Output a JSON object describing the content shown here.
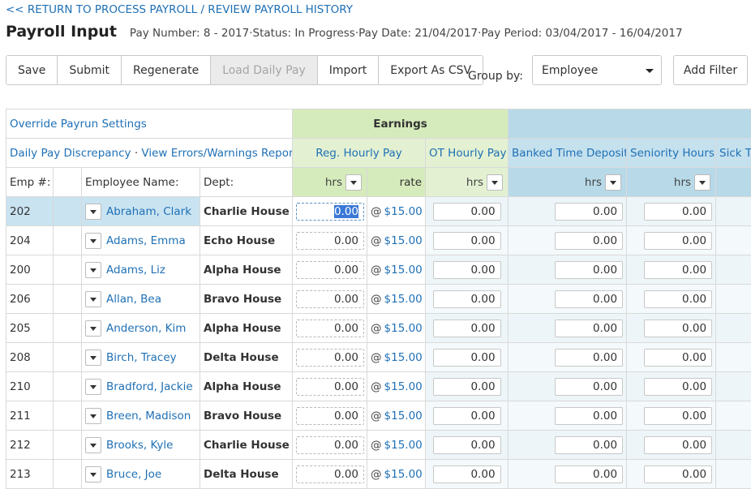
{
  "nav": {
    "return_link": "<< RETURN TO PROCESS PAYROLL / REVIEW PAYROLL HISTORY"
  },
  "header": {
    "title": "Payroll Input",
    "pay_number": "Pay Number: 8 - 2017",
    "status": "Status: In Progress",
    "pay_date": "Pay Date: 21/04/2017",
    "pay_period": "Pay Period: 03/04/2017 - 16/04/2017",
    "separator": "·"
  },
  "toolbar": {
    "save": "Save",
    "submit": "Submit",
    "regenerate": "Regenerate",
    "load_daily_pay": "Load Daily Pay",
    "import": "Import",
    "export_csv": "Export As CSV"
  },
  "group_by": {
    "label": "Group by:",
    "value": "Employee"
  },
  "add_filter": "Add Filter",
  "table": {
    "override_link": "Override Payrun Settings",
    "discrepancy_link": "Daily Pay Discrepancy",
    "link_sep": "·",
    "errors_link": "View Errors/Warnings Report",
    "earnings_title": "Earnings",
    "columns": {
      "reg_hourly": "Reg. Hourly Pay",
      "ot_hourly": "OT Hourly Pay",
      "banked": "Banked Time Deposit",
      "seniority": "Seniority Hours",
      "sick": "Sick Ti"
    },
    "headers": {
      "emp_no": "Emp #:",
      "emp_name": "Employee Name:",
      "dept": "Dept:",
      "hrs": "hrs",
      "rate": "rate"
    },
    "rows": [
      {
        "emp": "202",
        "name": "Abraham, Clark",
        "dept": "Charlie House",
        "reg_hrs": "0.00",
        "rate": "$15.00",
        "ot": "0.00",
        "banked": "0.00",
        "seniority": "0.00"
      },
      {
        "emp": "204",
        "name": "Adams, Emma",
        "dept": "Echo House",
        "reg_hrs": "0.00",
        "rate": "$15.00",
        "ot": "0.00",
        "banked": "0.00",
        "seniority": "0.00"
      },
      {
        "emp": "200",
        "name": "Adams, Liz",
        "dept": "Alpha House",
        "reg_hrs": "0.00",
        "rate": "$15.00",
        "ot": "0.00",
        "banked": "0.00",
        "seniority": "0.00"
      },
      {
        "emp": "206",
        "name": "Allan, Bea",
        "dept": "Bravo House",
        "reg_hrs": "0.00",
        "rate": "$15.00",
        "ot": "0.00",
        "banked": "0.00",
        "seniority": "0.00"
      },
      {
        "emp": "205",
        "name": "Anderson, Kim",
        "dept": "Alpha House",
        "reg_hrs": "0.00",
        "rate": "$15.00",
        "ot": "0.00",
        "banked": "0.00",
        "seniority": "0.00"
      },
      {
        "emp": "208",
        "name": "Birch, Tracey",
        "dept": "Delta House",
        "reg_hrs": "0.00",
        "rate": "$15.00",
        "ot": "0.00",
        "banked": "0.00",
        "seniority": "0.00"
      },
      {
        "emp": "210",
        "name": "Bradford, Jackie",
        "dept": "Alpha House",
        "reg_hrs": "0.00",
        "rate": "$15.00",
        "ot": "0.00",
        "banked": "0.00",
        "seniority": "0.00"
      },
      {
        "emp": "211",
        "name": "Breen, Madison",
        "dept": "Bravo House",
        "reg_hrs": "0.00",
        "rate": "$15.00",
        "ot": "0.00",
        "banked": "0.00",
        "seniority": "0.00"
      },
      {
        "emp": "212",
        "name": "Brooks, Kyle",
        "dept": "Charlie House",
        "reg_hrs": "0.00",
        "rate": "$15.00",
        "ot": "0.00",
        "banked": "0.00",
        "seniority": "0.00"
      },
      {
        "emp": "213",
        "name": "Bruce, Joe",
        "dept": "Delta House",
        "reg_hrs": "0.00",
        "rate": "$15.00",
        "ot": "0.00",
        "banked": "0.00",
        "seniority": "0.00"
      }
    ],
    "rate_prefix": "@"
  },
  "colors": {
    "link": "#1f70b5",
    "earnings_green": "#d6ebbb",
    "deduction_blue": "#b7d9e8",
    "selection": "#3a78d6"
  }
}
